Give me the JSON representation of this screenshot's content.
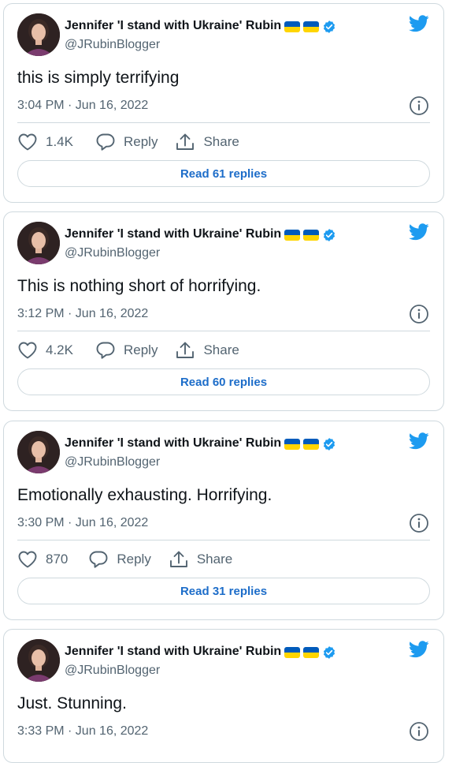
{
  "colors": {
    "accent": "#1d9bf0",
    "link_text": "#1d6dc9",
    "text_primary": "#0f1419",
    "text_secondary": "#536471",
    "border": "#cfd9de",
    "flag_blue": "#005bbb",
    "flag_yellow": "#ffd500"
  },
  "icons": {
    "brand": "twitter-bird-icon",
    "verified": "verified-badge-icon",
    "info": "info-icon",
    "like": "heart-icon",
    "reply": "reply-bubble-icon",
    "share": "share-icon",
    "flag": "ukraine-flag-icon"
  },
  "tweets": [
    {
      "display_name": "Jennifer 'I stand with Ukraine' Rubin",
      "handle": "@JRubinBlogger",
      "text": "this is simply terrifying",
      "timestamp": "3:04 PM · Jun 16, 2022",
      "likes": "1.4K",
      "reply_label": "Reply",
      "share_label": "Share",
      "read_replies": "Read 61 replies"
    },
    {
      "display_name": "Jennifer 'I stand with Ukraine' Rubin",
      "handle": "@JRubinBlogger",
      "text": "This is nothing short of horrifying.",
      "timestamp": "3:12 PM · Jun 16, 2022",
      "likes": "4.2K",
      "reply_label": "Reply",
      "share_label": "Share",
      "read_replies": "Read 60 replies"
    },
    {
      "display_name": "Jennifer 'I stand with Ukraine' Rubin",
      "handle": "@JRubinBlogger",
      "text": "Emotionally exhausting. Horrifying.",
      "timestamp": "3:30 PM · Jun 16, 2022",
      "likes": "870",
      "reply_label": "Reply",
      "share_label": "Share",
      "read_replies": "Read 31 replies"
    },
    {
      "display_name": "Jennifer 'I stand with Ukraine' Rubin",
      "handle": "@JRubinBlogger",
      "text": "Just. Stunning.",
      "timestamp": "3:33 PM · Jun 16, 2022"
    }
  ]
}
